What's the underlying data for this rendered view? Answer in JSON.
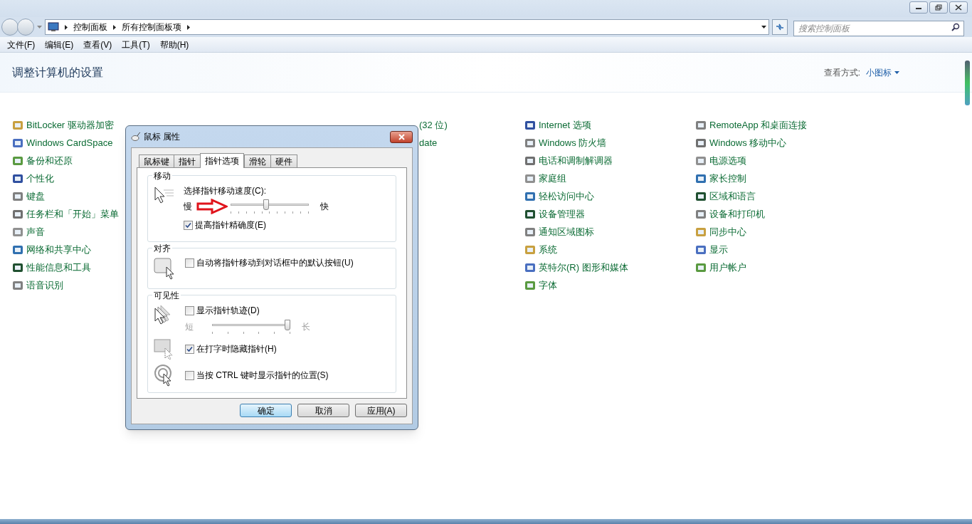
{
  "address_bar": {
    "breadcrumbs": [
      "控制面板",
      "所有控制面板项"
    ],
    "search": {
      "placeholder": "搜索控制面板"
    }
  },
  "menu_bar": [
    "文件(F)",
    "编辑(E)",
    "查看(V)",
    "工具(T)",
    "帮助(H)"
  ],
  "header": {
    "title": "调整计算机的设置",
    "view_label": "查看方式:",
    "view_value": "小图标"
  },
  "columns": [
    [
      {
        "label": "BitLocker 驱动器加密"
      },
      {
        "label": "Windows CardSpace"
      },
      {
        "label": "备份和还原"
      },
      {
        "label": "个性化"
      },
      {
        "label": "键盘"
      },
      {
        "label": "任务栏和「开始」菜单"
      },
      {
        "label": "声音"
      },
      {
        "label": "网络和共享中心"
      },
      {
        "label": "性能信息和工具"
      },
      {
        "label": "语音识别"
      }
    ],
    [],
    [
      {
        "label": "(32 位)"
      },
      {
        "label": "date"
      }
    ],
    [
      {
        "label": "Internet 选项"
      },
      {
        "label": "Windows 防火墙"
      },
      {
        "label": "电话和调制解调器"
      },
      {
        "label": "家庭组"
      },
      {
        "label": "轻松访问中心"
      },
      {
        "label": "设备管理器"
      },
      {
        "label": "通知区域图标"
      },
      {
        "label": "系统"
      },
      {
        "label": "英特尔(R) 图形和媒体"
      },
      {
        "label": "字体"
      }
    ],
    [
      {
        "label": "RemoteApp 和桌面连接"
      },
      {
        "label": "Windows 移动中心"
      },
      {
        "label": "电源选项"
      },
      {
        "label": "家长控制"
      },
      {
        "label": "区域和语言"
      },
      {
        "label": "设备和打印机"
      },
      {
        "label": "同步中心"
      },
      {
        "label": "显示"
      },
      {
        "label": "用户帐户"
      }
    ]
  ],
  "dialog": {
    "title": "鼠标 属性",
    "tabs": [
      {
        "label": "鼠标键",
        "selected": false
      },
      {
        "label": "指针",
        "selected": false
      },
      {
        "label": "指针选项",
        "selected": true
      },
      {
        "label": "滑轮",
        "selected": false
      },
      {
        "label": "硬件",
        "selected": false
      }
    ],
    "motion": {
      "legend": "移动",
      "speed_label": "选择指针移动速度(C):",
      "slow": "慢",
      "fast": "快",
      "level": 0.45,
      "precision": {
        "label": "提高指针精确度(E)",
        "checked": true
      }
    },
    "snap": {
      "legend": "对齐",
      "option": {
        "label": "自动将指针移动到对话框中的默认按钮(U)",
        "checked": false
      }
    },
    "visibility": {
      "legend": "可见性",
      "trails": {
        "label": "显示指针轨迹(D)",
        "checked": false
      },
      "short": "短",
      "long": "长",
      "trail": {
        "level": 1
      },
      "hide": {
        "label": "在打字时隐藏指针(H)",
        "checked": true
      },
      "ctrl": {
        "label": "当按 CTRL 键时显示指针的位置(S)",
        "checked": false
      }
    },
    "buttons": [
      {
        "label": "确定",
        "default": true
      },
      {
        "label": "取消",
        "default": false
      },
      {
        "label": "应用(A)",
        "default": false
      }
    ]
  }
}
